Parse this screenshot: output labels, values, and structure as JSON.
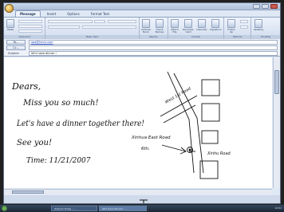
{
  "tabs": [
    "Message",
    "Insert",
    "Options",
    "Format Text"
  ],
  "ribbon": {
    "groups": [
      "Clipboard",
      "Basic Text",
      "Names",
      "Include",
      "Options",
      "Proofing"
    ],
    "buttons": [
      "Paste",
      "Address Book",
      "Check Names",
      "Attach File",
      "Business Card",
      "Calendar",
      "Signature",
      "Follow Up",
      "Spelling"
    ]
  },
  "fields": {
    "to_label": "To...",
    "cc_label": "Cc...",
    "subject_label": "Subject:",
    "to_value": "aaa@hmm.com",
    "cc_value": "",
    "subject_value": "let's have dinner !"
  },
  "note": {
    "greeting": "Dears,",
    "line1": "Miss you so much!",
    "line2": "Let's have a dinner together there!",
    "line3": "See you!",
    "time": "Time: 11/21/2007",
    "map_street1": "West 1st Road",
    "map_street2": "Xinhu Road",
    "map_label1": "Xinhua East Road",
    "map_label2": "6th."
  },
  "taskbar": {
    "items": [
      "Outlook Today - ...",
      "let's have dinner! ..."
    ],
    "clock": "12:01"
  }
}
